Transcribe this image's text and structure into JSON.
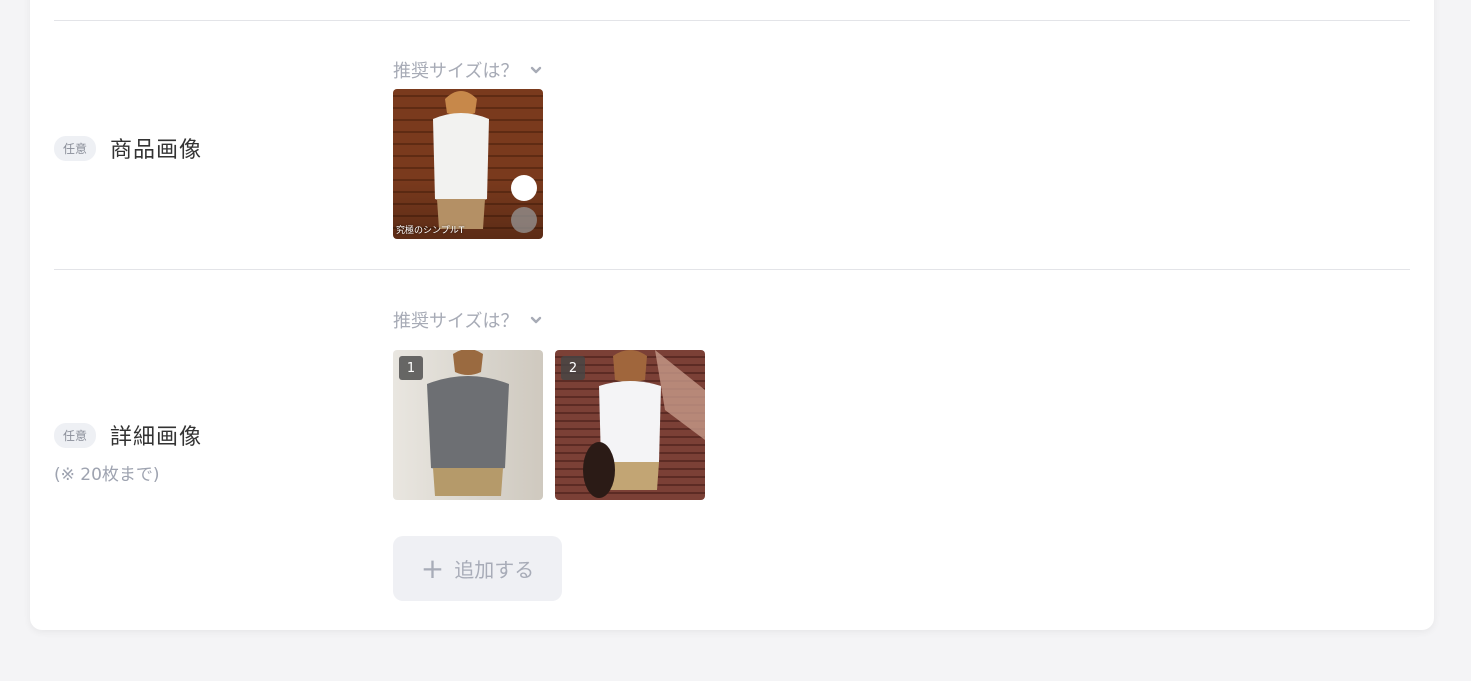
{
  "product_image": {
    "badge": "任意",
    "title": "商品画像",
    "hint": "推奨サイズは？",
    "caption": "究極のシンプルT"
  },
  "detail_images": {
    "badge": "任意",
    "title": "詳細画像",
    "note": "(※ 20枚まで)",
    "hint": "推奨サイズは？",
    "items": [
      {
        "number": "1"
      },
      {
        "number": "2"
      }
    ],
    "add_label": "追加する"
  },
  "icons": {
    "hint_chevron": "chevron-down-icon",
    "add_button": "plus-icon"
  },
  "colors": {
    "badge_bg": "#eef0f4",
    "hint_text": "#a7abb6",
    "button_bg": "#eff0f4"
  }
}
